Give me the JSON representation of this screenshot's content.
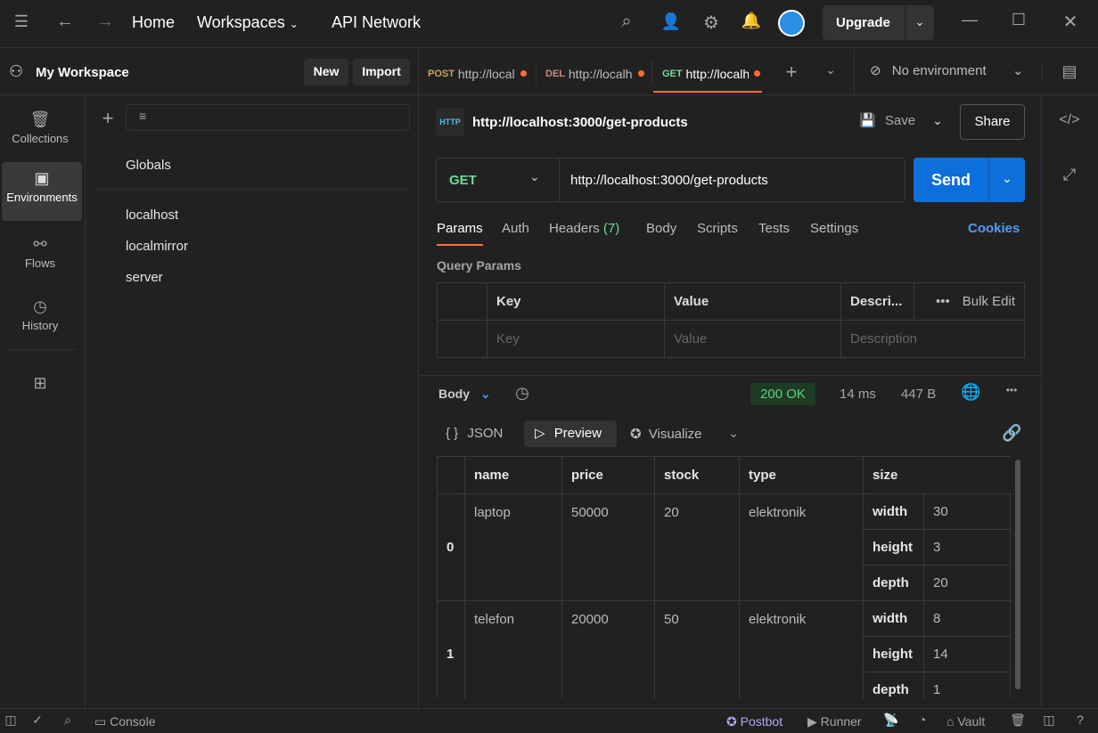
{
  "topbar": {
    "nav": [
      "Home",
      "Workspaces",
      "API Network"
    ],
    "upgrade": "Upgrade"
  },
  "workspace": {
    "title": "My Workspace",
    "new": "New",
    "import": "Import"
  },
  "rail": [
    {
      "label": "Collections",
      "icon": "trash-can-icon"
    },
    {
      "label": "Environments",
      "icon": "environment-icon"
    },
    {
      "label": "Flows",
      "icon": "flows-icon"
    },
    {
      "label": "History",
      "icon": "history-icon"
    }
  ],
  "sidebar": {
    "globals": "Globals",
    "environments": [
      "localhost",
      "localmirror",
      "server"
    ]
  },
  "tabs": [
    {
      "method": "POST",
      "url": "http://localhost",
      "color": "#c9a55a"
    },
    {
      "method": "DEL",
      "url": "http://localhost",
      "color": "#d08a7a"
    },
    {
      "method": "GET",
      "url": "http://localhost",
      "color": "#6bdd9a"
    }
  ],
  "environment": "No environment",
  "request": {
    "title": "http://localhost:3000/get-products",
    "save": "Save",
    "share": "Share",
    "method": "GET",
    "url": "http://localhost:3000/get-products",
    "send": "Send"
  },
  "request_tabs": {
    "params": "Params",
    "auth": "Auth",
    "headers": "Headers",
    "headers_count": "(7)",
    "body": "Body",
    "scripts": "Scripts",
    "tests": "Tests",
    "settings": "Settings",
    "cookies": "Cookies"
  },
  "query_params": {
    "title": "Query Params",
    "headers": [
      "Key",
      "Value",
      "Descri..."
    ],
    "bulk_edit": "Bulk Edit",
    "placeholders": [
      "Key",
      "Value",
      "Description"
    ]
  },
  "response": {
    "body": "Body",
    "status": "200 OK",
    "time": "14 ms",
    "size": "447 B",
    "views": [
      "JSON",
      "Preview",
      "Visualize"
    ],
    "columns": [
      "name",
      "price",
      "stock",
      "type",
      "size"
    ],
    "rows": [
      {
        "index": "0",
        "name": "laptop",
        "price": "50000",
        "stock": "20",
        "type": "elektronik",
        "size": [
          [
            "width",
            "30"
          ],
          [
            "height",
            "3"
          ],
          [
            "depth",
            "20"
          ]
        ]
      },
      {
        "index": "1",
        "name": "telefon",
        "price": "20000",
        "stock": "50",
        "type": "elektronik",
        "size": [
          [
            "width",
            "8"
          ],
          [
            "height",
            "14"
          ],
          [
            "depth",
            "1"
          ]
        ]
      }
    ]
  },
  "statusbar": {
    "console": "Console",
    "postbot": "Postbot",
    "runner": "Runner",
    "vault": "Vault"
  }
}
